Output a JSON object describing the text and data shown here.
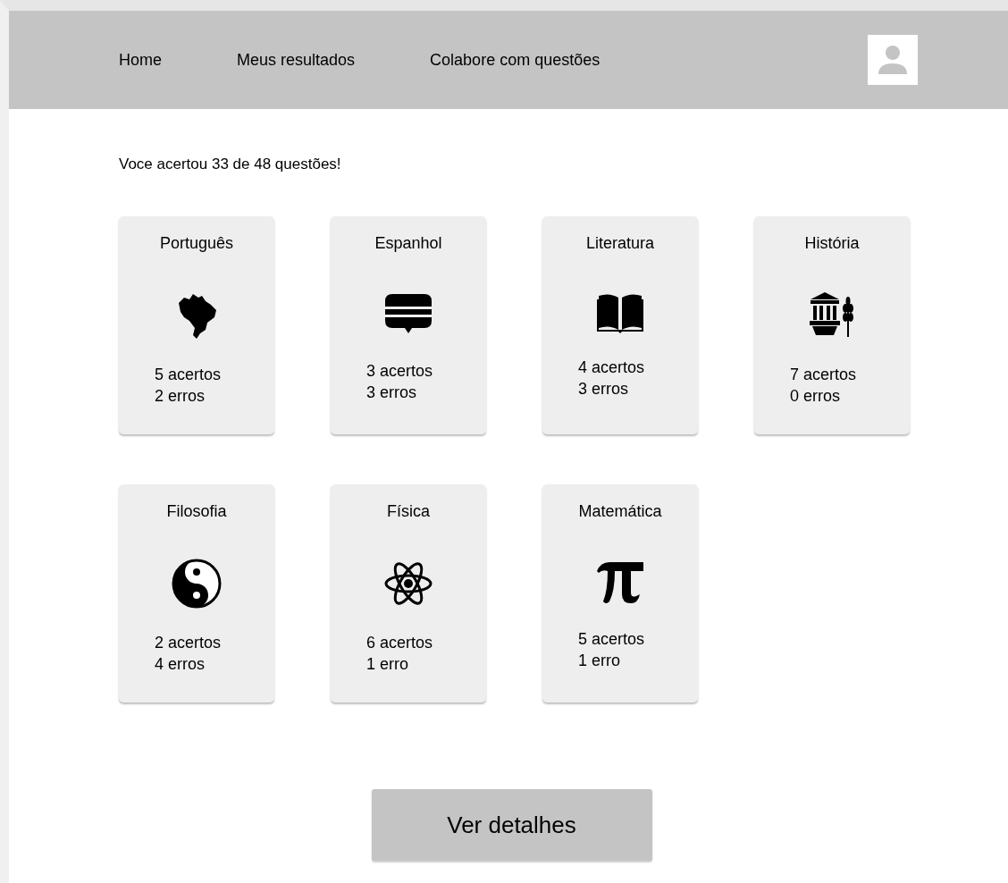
{
  "nav": {
    "items": [
      "Home",
      "Meus resultados",
      "Colabore com questões"
    ]
  },
  "summary": "Voce acertou 33 de 48 questões!",
  "subjects": [
    {
      "title": "Português",
      "kind": "map",
      "correct": "5 acertos",
      "wrong": "2 erros"
    },
    {
      "title": "Espanhol",
      "kind": "chat",
      "correct": "3 acertos",
      "wrong": "3 erros"
    },
    {
      "title": "Literatura",
      "kind": "book",
      "correct": "4 acertos",
      "wrong": "3 erros"
    },
    {
      "title": "História",
      "kind": "museum",
      "correct": "7 acertos",
      "wrong": "0 erros"
    },
    {
      "title": "Filosofia",
      "kind": "yinyang",
      "correct": "2 acertos",
      "wrong": "4 erros"
    },
    {
      "title": "Física",
      "kind": "atom",
      "correct": "6 acertos",
      "wrong": "1 erro"
    },
    {
      "title": "Matemática",
      "kind": "pi",
      "correct": "5 acertos",
      "wrong": "1 erro"
    }
  ],
  "details_button": "Ver detalhes"
}
